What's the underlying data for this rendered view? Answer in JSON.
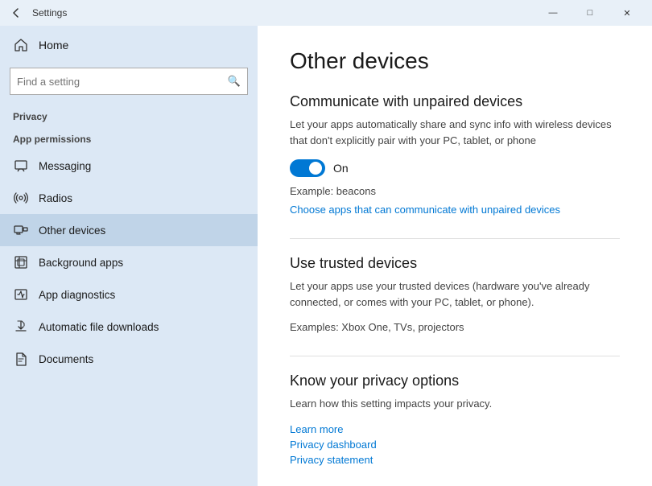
{
  "titlebar": {
    "title": "Settings",
    "back_icon": "←",
    "minimize_label": "—",
    "maximize_label": "□",
    "close_label": "✕"
  },
  "sidebar": {
    "home_label": "Home",
    "search_placeholder": "Find a setting",
    "section_title": "Privacy",
    "app_permissions_label": "App permissions",
    "items": [
      {
        "id": "messaging",
        "label": "Messaging"
      },
      {
        "id": "radios",
        "label": "Radios"
      },
      {
        "id": "other-devices",
        "label": "Other devices",
        "active": true
      },
      {
        "id": "background-apps",
        "label": "Background apps"
      },
      {
        "id": "app-diagnostics",
        "label": "App diagnostics"
      },
      {
        "id": "automatic-file-downloads",
        "label": "Automatic file downloads"
      },
      {
        "id": "documents",
        "label": "Documents"
      }
    ]
  },
  "content": {
    "page_title": "Other devices",
    "sections": [
      {
        "id": "communicate",
        "title": "Communicate with unpaired devices",
        "description": "Let your apps automatically share and sync info with wireless devices that don't explicitly pair with your PC, tablet, or phone",
        "toggle_on": true,
        "toggle_label": "On",
        "example_text": "Example: beacons",
        "link_text": "Choose apps that can communicate with unpaired devices"
      },
      {
        "id": "trusted",
        "title": "Use trusted devices",
        "description": "Let your apps use your trusted devices (hardware you've already connected, or comes with your PC, tablet, or phone).",
        "example_text": "Examples: Xbox One, TVs, projectors"
      },
      {
        "id": "privacy-options",
        "title": "Know your privacy options",
        "description": "Learn how this setting impacts your privacy.",
        "links": [
          "Learn more",
          "Privacy dashboard",
          "Privacy statement"
        ]
      }
    ]
  }
}
